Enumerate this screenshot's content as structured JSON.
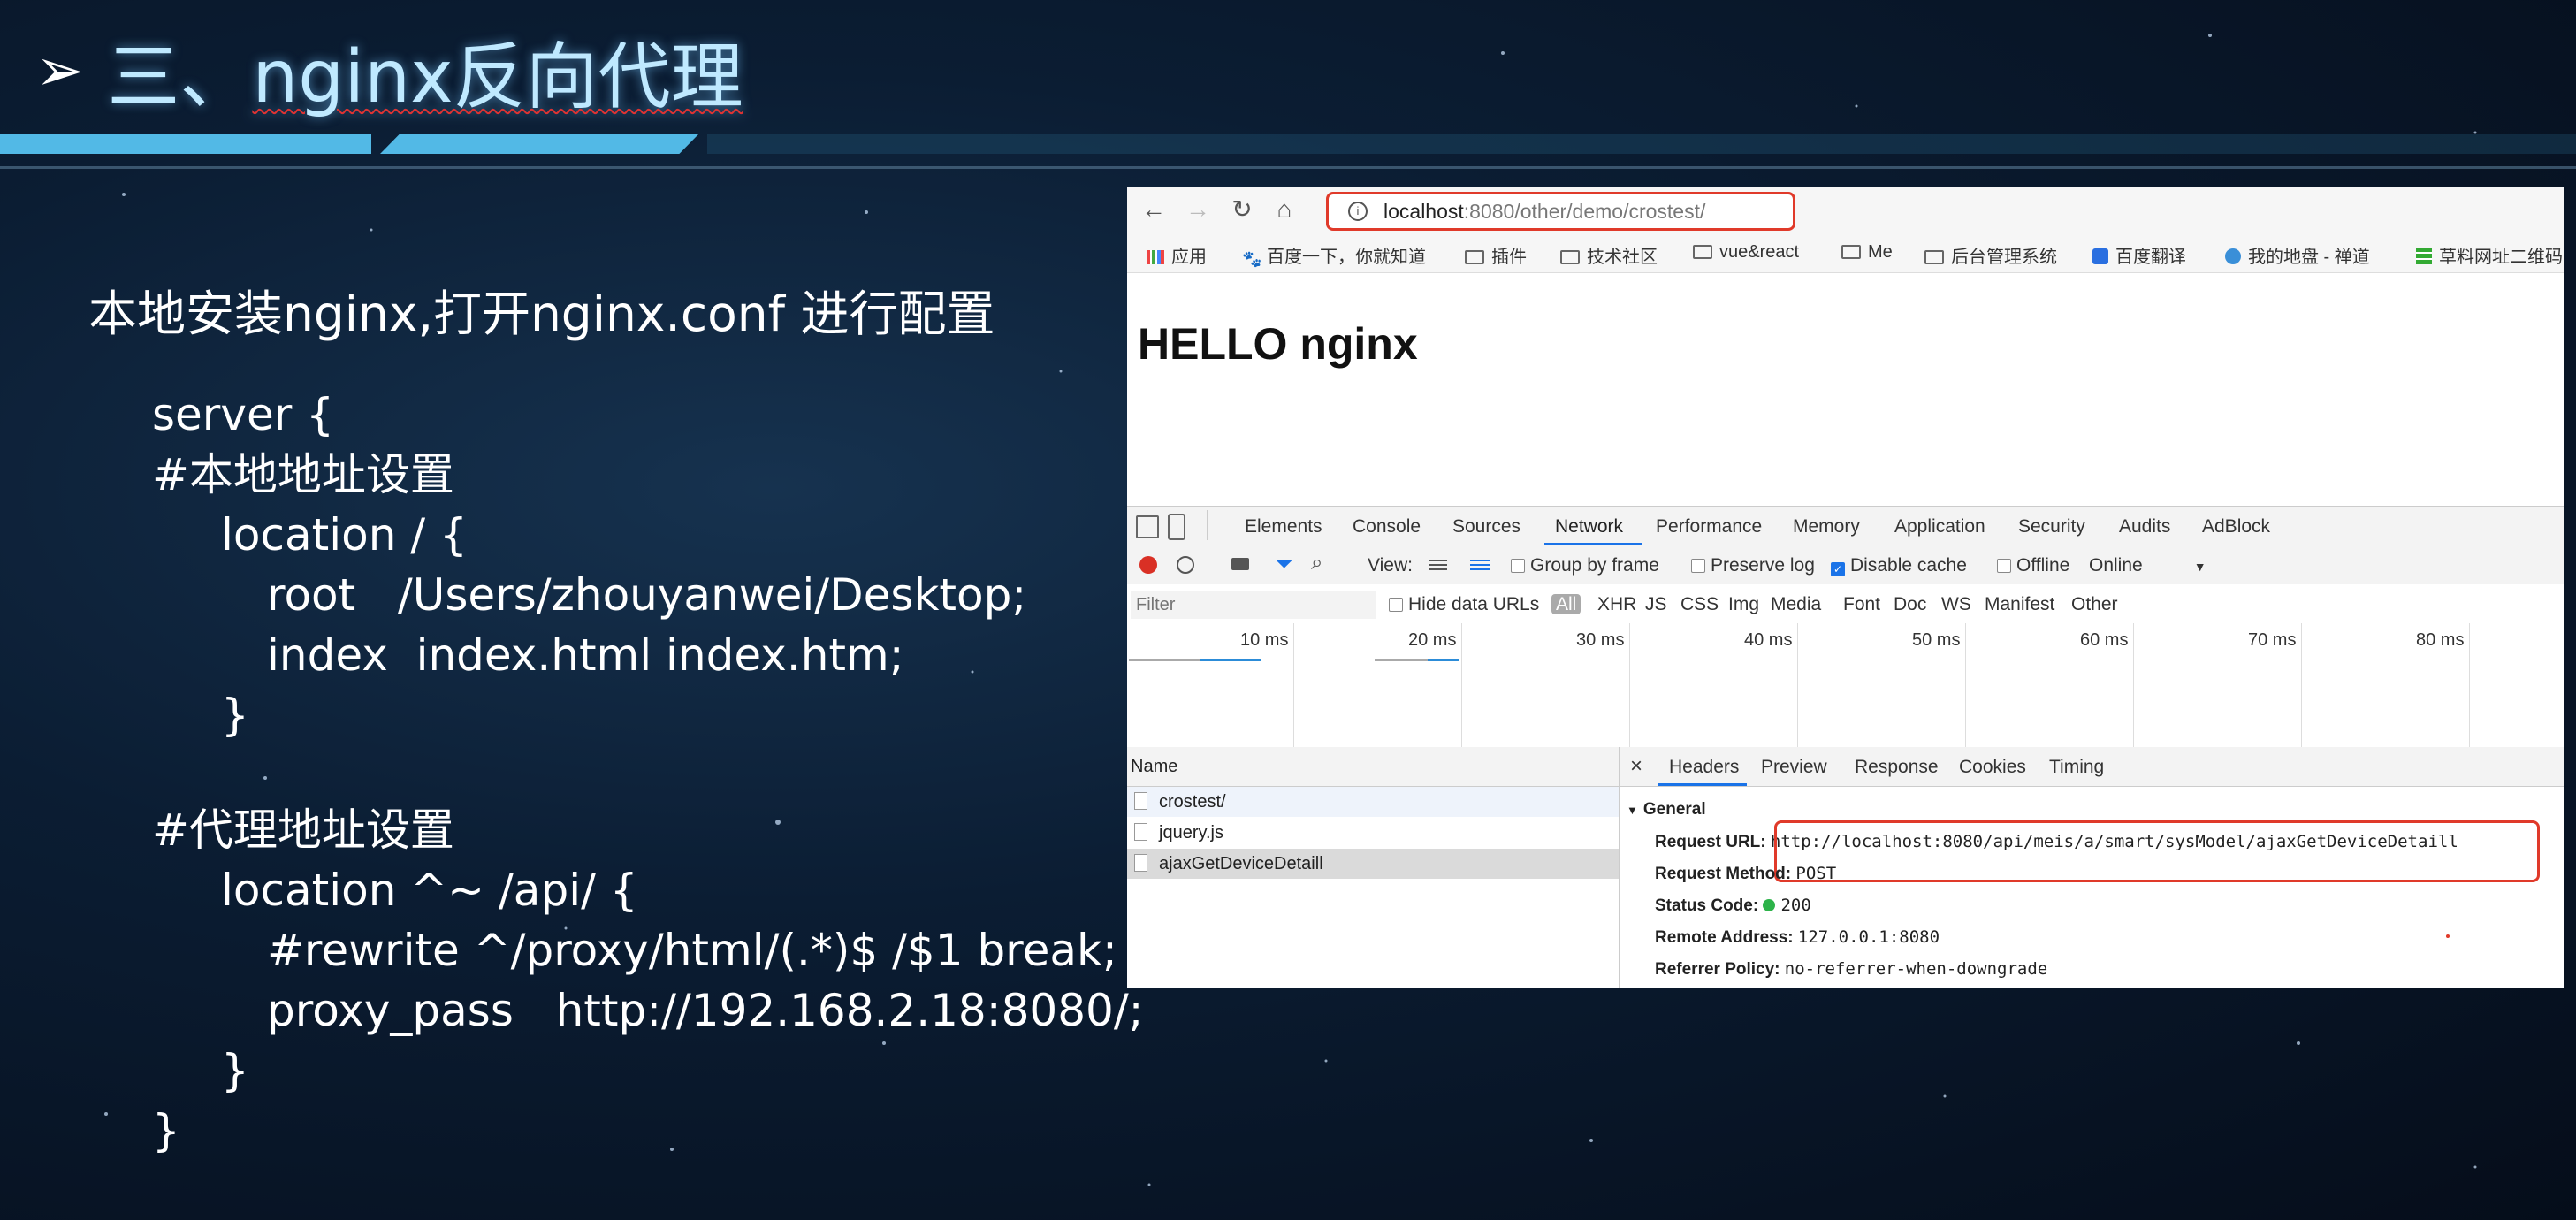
{
  "slide": {
    "title_prefix": "三、",
    "title_main": "nginx反向代理",
    "intro": "本地安装nginx,打开nginx.conf 进行配置",
    "code_lines": [
      "server {",
      "#本地地址设置",
      "location / {",
      "root   /Users/zhouyanwei/Desktop;",
      "index  index.html index.htm;",
      "}",
      "#代理地址设置",
      "location ^~ /api/ {",
      "#rewrite ^/proxy/html/(.*)$ /$1 break;",
      "proxy_pass   http://192.168.2.18:8080/;",
      "}",
      "}"
    ]
  },
  "browser": {
    "url_host": "localhost",
    "url_rest": ":8080/other/demo/crostest/",
    "bookmarks": [
      "应用",
      "百度一下，你就知道",
      "插件",
      "技术社区",
      "vue&react",
      "Me",
      "后台管理系统",
      "百度翻译",
      "我的地盘 - 禅道",
      "草料网址二维码"
    ],
    "page_heading": "HELLO nginx"
  },
  "devtools": {
    "tabs": [
      "Elements",
      "Console",
      "Sources",
      "Network",
      "Performance",
      "Memory",
      "Application",
      "Security",
      "Audits",
      "AdBlock"
    ],
    "active_tab": "Network",
    "toolbar": {
      "view_label": "View:",
      "group_by_frame": "Group by frame",
      "preserve_log": "Preserve log",
      "disable_cache": "Disable cache",
      "offline": "Offline",
      "throttle": "Online"
    },
    "filter_placeholder": "Filter",
    "hide_data_urls": "Hide data URLs",
    "type_filters": [
      "All",
      "XHR",
      "JS",
      "CSS",
      "Img",
      "Media",
      "Font",
      "Doc",
      "WS",
      "Manifest",
      "Other"
    ],
    "timeline_ticks": [
      "10 ms",
      "20 ms",
      "30 ms",
      "40 ms",
      "50 ms",
      "60 ms",
      "70 ms",
      "80 ms"
    ],
    "name_header": "Name",
    "requests": [
      "crostest/",
      "jquery.js",
      "ajaxGetDeviceDetaill"
    ],
    "detail_tabs": [
      "Headers",
      "Preview",
      "Response",
      "Cookies",
      "Timing"
    ],
    "close_glyph": "×",
    "general_label": "General",
    "general": {
      "request_url_label": "Request URL:",
      "request_url": "http://localhost:8080/api/meis/a/smart/sysModel/ajaxGetDeviceDetaill",
      "request_method_label": "Request Method:",
      "request_method": "POST",
      "status_code_label": "Status Code:",
      "status_code": "200",
      "remote_address_label": "Remote Address:",
      "remote_address": "127.0.0.1:8080",
      "referrer_policy_label": "Referrer Policy:",
      "referrer_policy": "no-referrer-when-downgrade"
    }
  },
  "colors": {
    "highlight_box": "#e03a2a",
    "title_glow": "#bfe9ff",
    "band": "#52b9e6"
  }
}
